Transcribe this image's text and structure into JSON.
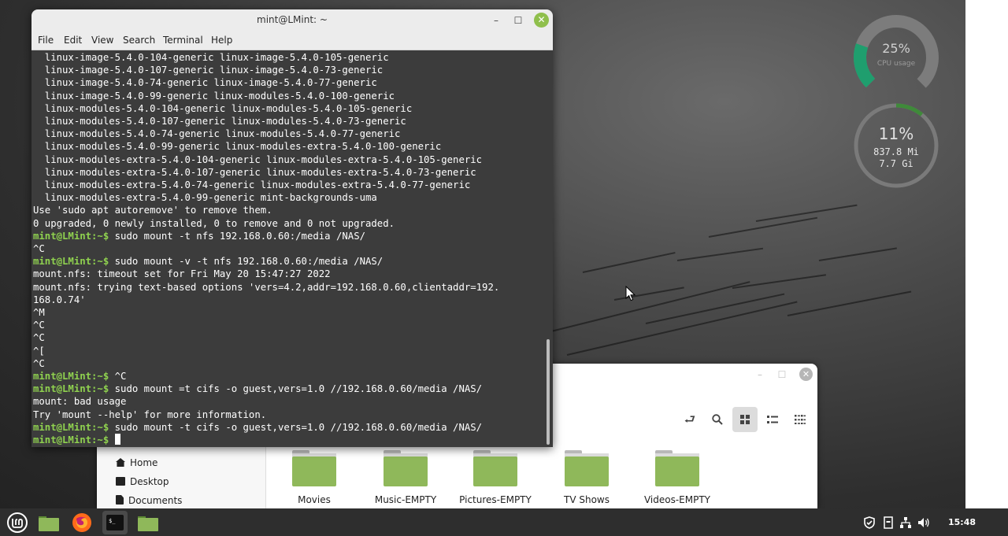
{
  "desklets": {
    "cpu": {
      "percent": "25%",
      "label": "CPU usage",
      "value": 0.25
    },
    "memory": {
      "percent": "11%",
      "used": "837.8 Mi",
      "total": "7.7 Gi",
      "value": 0.11
    }
  },
  "file_manager": {
    "toolbar": {
      "icons": [
        "toggle-location-icon",
        "search-icon",
        "icon-view-icon",
        "list-view-icon",
        "compact-view-icon"
      ]
    },
    "sidebar": {
      "items": [
        {
          "label": "Home",
          "icon": "home-icon"
        },
        {
          "label": "Desktop",
          "icon": "desktop-icon"
        },
        {
          "label": "Documents",
          "icon": "documents-icon"
        }
      ]
    },
    "folders": [
      {
        "label": "Movies"
      },
      {
        "label": "Music-EMPTY"
      },
      {
        "label": "Pictures-EMPTY"
      },
      {
        "label": "TV Shows"
      },
      {
        "label": "Videos-EMPTY"
      }
    ],
    "colors": {
      "folder": "#8fb85a"
    }
  },
  "terminal": {
    "title": "mint@LMint: ~",
    "menu": [
      "File",
      "Edit",
      "View",
      "Search",
      "Terminal",
      "Help"
    ],
    "prompt": "mint@LMint:~$",
    "lines": [
      {
        "text": "  linux-image-5.4.0-104-generic linux-image-5.4.0-105-generic"
      },
      {
        "text": "  linux-image-5.4.0-107-generic linux-image-5.4.0-73-generic"
      },
      {
        "text": "  linux-image-5.4.0-74-generic linux-image-5.4.0-77-generic"
      },
      {
        "text": "  linux-image-5.4.0-99-generic linux-modules-5.4.0-100-generic"
      },
      {
        "text": "  linux-modules-5.4.0-104-generic linux-modules-5.4.0-105-generic"
      },
      {
        "text": "  linux-modules-5.4.0-107-generic linux-modules-5.4.0-73-generic"
      },
      {
        "text": "  linux-modules-5.4.0-74-generic linux-modules-5.4.0-77-generic"
      },
      {
        "text": "  linux-modules-5.4.0-99-generic linux-modules-extra-5.4.0-100-generic"
      },
      {
        "text": "  linux-modules-extra-5.4.0-104-generic linux-modules-extra-5.4.0-105-generic"
      },
      {
        "text": "  linux-modules-extra-5.4.0-107-generic linux-modules-extra-5.4.0-73-generic"
      },
      {
        "text": "  linux-modules-extra-5.4.0-74-generic linux-modules-extra-5.4.0-77-generic"
      },
      {
        "text": "  linux-modules-extra-5.4.0-99-generic mint-backgrounds-uma"
      },
      {
        "text": "Use 'sudo apt autoremove' to remove them."
      },
      {
        "text": "0 upgraded, 0 newly installed, 0 to remove and 0 not upgraded."
      },
      {
        "prompt": true,
        "text": " sudo mount -t nfs 192.168.0.60:/media /NAS/"
      },
      {
        "text": "^C"
      },
      {
        "prompt": true,
        "text": " sudo mount -v -t nfs 192.168.0.60:/media /NAS/"
      },
      {
        "text": "mount.nfs: timeout set for Fri May 20 15:47:27 2022"
      },
      {
        "text": "mount.nfs: trying text-based options 'vers=4.2,addr=192.168.0.60,clientaddr=192."
      },
      {
        "text": "168.0.74'"
      },
      {
        "text": "^M"
      },
      {
        "text": "^C"
      },
      {
        "text": "^C"
      },
      {
        "text": "^["
      },
      {
        "text": "^C"
      },
      {
        "prompt": true,
        "text": " ^C"
      },
      {
        "prompt": true,
        "text": " sudo mount =t cifs -o guest,vers=1.0 //192.168.0.60/media /NAS/"
      },
      {
        "text": "mount: bad usage"
      },
      {
        "text": "Try 'mount --help' for more information."
      },
      {
        "prompt": true,
        "text": " sudo mount -t cifs -o guest,vers=1.0 //192.168.0.60/media /NAS/"
      },
      {
        "prompt": true,
        "text": " ",
        "cursor": true
      }
    ],
    "colors": {
      "background": "#3c3c3c",
      "prompt": "#8fd14f",
      "text": "#ffffff",
      "close_button": "#8fbf4c"
    }
  },
  "taskbar": {
    "launchers": [
      {
        "name": "menu-button",
        "icon": "linux-mint-logo-icon"
      },
      {
        "name": "show-desktop",
        "icon": "folder-green-icon"
      },
      {
        "name": "firefox",
        "icon": "firefox-icon"
      },
      {
        "name": "terminal",
        "icon": "terminal-icon"
      },
      {
        "name": "files",
        "icon": "folder-green-icon"
      }
    ],
    "tray": [
      "shield-icon",
      "notes-icon",
      "network-icon",
      "volume-icon"
    ],
    "clock": "15:48"
  }
}
